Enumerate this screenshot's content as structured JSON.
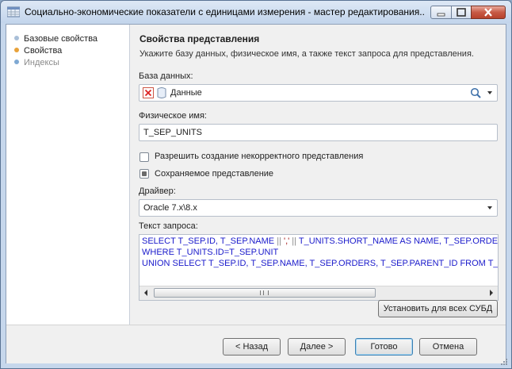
{
  "window": {
    "title": "Социально-экономические показатели с единицами измерения - мастер редактирования..."
  },
  "nav": {
    "items": [
      {
        "label": "Базовые свойства",
        "state": "done"
      },
      {
        "label": "Свойства",
        "state": "current"
      },
      {
        "label": "Индексы",
        "state": "pending"
      }
    ]
  },
  "section": {
    "title": "Свойства представления",
    "description": "Укажите базу данных, физическое имя, а также текст запроса для представления."
  },
  "database": {
    "label": "База данных:",
    "value": "Данные"
  },
  "physical_name": {
    "label": "Физическое имя:",
    "value": "T_SEP_UNITS"
  },
  "options": {
    "allow_invalid": {
      "label": "Разрешить создание некорректного представления",
      "checked": false
    },
    "persisted": {
      "label": "Сохраняемое представление",
      "checked": true
    }
  },
  "driver": {
    "label": "Драйвер:",
    "value": "Oracle 7.x\\8.x"
  },
  "query": {
    "label": "Текст запроса:",
    "line1": {
      "p1": "SELECT T_SEP.ID, T_SEP.NAME ",
      "p2": "||",
      "p3": " '",
      "p4": ",",
      "p5": "' ",
      "p6": "||",
      "p7": " T_UNITS.SHORT_NAME AS NAME, T_SEP.ORDER"
    },
    "line2": "WHERE T_UNITS.ID=T_SEP.UNIT",
    "line3": "UNION SELECT T_SEP.ID, T_SEP.NAME, T_SEP.ORDERS, T_SEP.PARENT_ID FROM T_S"
  },
  "buttons": {
    "set_all": "Установить для всех СУБД",
    "back": "< Назад",
    "next": "Далее >",
    "finish": "Готово",
    "cancel": "Отмена"
  },
  "colors": {
    "accent_done": "#a9bfd8",
    "accent_current": "#e8a23a",
    "accent_pending": "#7fa9d3",
    "sql_keyword": "#1a1acb",
    "sql_string": "#a31515"
  }
}
